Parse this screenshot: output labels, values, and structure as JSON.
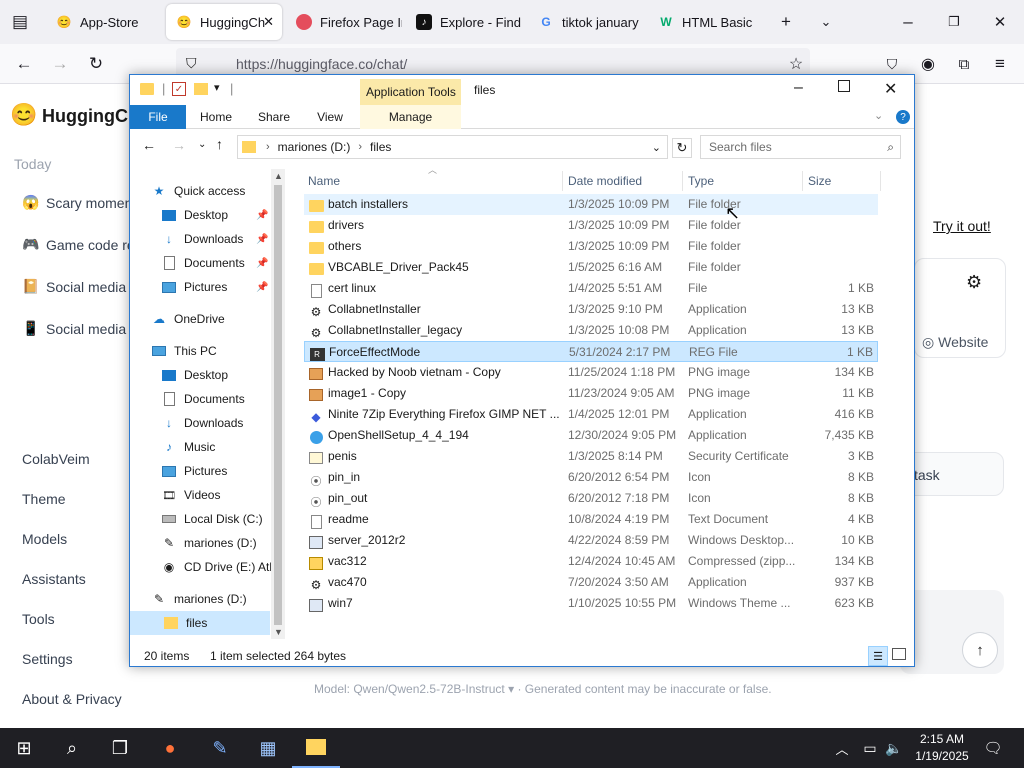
{
  "browser": {
    "tabs": [
      {
        "label": "App-Store",
        "icon": "hugging-face-icon"
      },
      {
        "label": "HuggingCh",
        "icon": "hugging-face-icon",
        "active": true
      },
      {
        "label": "Firefox Page In",
        "icon": "firefox-icon"
      },
      {
        "label": "Explore - Find",
        "icon": "tiktok-icon"
      },
      {
        "label": "tiktok january",
        "icon": "google-icon"
      },
      {
        "label": "HTML Basic",
        "icon": "w3schools-icon"
      }
    ],
    "url": "https://huggingface.co/chat/"
  },
  "page": {
    "brand": "HuggingCh",
    "today": "Today",
    "chats": [
      "Scary momen",
      "Game code re",
      "Social media b",
      "Social media ap"
    ],
    "menu": [
      "ColabVeim",
      "Theme",
      "Models",
      "Assistants",
      "Tools",
      "Settings",
      "About & Privacy"
    ],
    "try_it": "Try it out!",
    "website": "Website",
    "task": "task",
    "footer": "Model: Qwen/Qwen2.5-72B-Instruct ▾ · Generated content may be inaccurate or false."
  },
  "explorer": {
    "title": "files",
    "app_tools": "Application Tools",
    "ribbon": {
      "file": "File",
      "home": "Home",
      "share": "Share",
      "view": "View",
      "manage": "Manage"
    },
    "address": {
      "drive": "mariones (D:)",
      "folder": "files"
    },
    "search_placeholder": "Search files",
    "nav": {
      "quick_access": "Quick access",
      "qa_items": [
        "Desktop",
        "Downloads",
        "Documents",
        "Pictures"
      ],
      "onedrive": "OneDrive",
      "this_pc": "This PC",
      "pc_items": [
        "Desktop",
        "Documents",
        "Downloads",
        "Music",
        "Pictures",
        "Videos",
        "Local Disk (C:)",
        "mariones (D:)",
        "CD Drive (E:) Atla"
      ],
      "drive": "mariones (D:)",
      "files": "files"
    },
    "columns": {
      "name": "Name",
      "date": "Date modified",
      "type": "Type",
      "size": "Size"
    },
    "files": [
      {
        "name": "batch installers",
        "date": "1/3/2025 10:09 PM",
        "type": "File folder",
        "size": "",
        "icon": "folder-icon"
      },
      {
        "name": "drivers",
        "date": "1/3/2025 10:09 PM",
        "type": "File folder",
        "size": "",
        "icon": "folder-icon"
      },
      {
        "name": "others",
        "date": "1/3/2025 10:09 PM",
        "type": "File folder",
        "size": "",
        "icon": "folder-icon"
      },
      {
        "name": "VBCABLE_Driver_Pack45",
        "date": "1/5/2025 6:16 AM",
        "type": "File folder",
        "size": "",
        "icon": "folder-icon"
      },
      {
        "name": "cert linux",
        "date": "1/4/2025 5:51 AM",
        "type": "File",
        "size": "1 KB",
        "icon": "file-icon"
      },
      {
        "name": "CollabnetInstaller",
        "date": "1/3/2025 9:10 PM",
        "type": "Application",
        "size": "13 KB",
        "icon": "app-icon"
      },
      {
        "name": "CollabnetInstaller_legacy",
        "date": "1/3/2025 10:08 PM",
        "type": "Application",
        "size": "13 KB",
        "icon": "app-icon"
      },
      {
        "name": "ForceEffectMode",
        "date": "5/31/2024 2:17 PM",
        "type": "REG File",
        "size": "1 KB",
        "icon": "reg-icon"
      },
      {
        "name": "Hacked by Noob vietnam - Copy",
        "date": "11/25/2024 1:18 PM",
        "type": "PNG image",
        "size": "134 KB",
        "icon": "image-icon"
      },
      {
        "name": "image1 - Copy",
        "date": "11/23/2024 9:05 AM",
        "type": "PNG image",
        "size": "11 KB",
        "icon": "image-icon"
      },
      {
        "name": "Ninite 7Zip Everything Firefox GIMP NET ...",
        "date": "1/4/2025 12:01 PM",
        "type": "Application",
        "size": "416 KB",
        "icon": "ninite-icon"
      },
      {
        "name": "OpenShellSetup_4_4_194",
        "date": "12/30/2024 9:05 PM",
        "type": "Application",
        "size": "7,435 KB",
        "icon": "shell-icon"
      },
      {
        "name": "penis",
        "date": "1/3/2025 8:14 PM",
        "type": "Security Certificate",
        "size": "3 KB",
        "icon": "certificate-icon"
      },
      {
        "name": "pin_in",
        "date": "6/20/2012 6:54 PM",
        "type": "Icon",
        "size": "8 KB",
        "icon": "pin-icon"
      },
      {
        "name": "pin_out",
        "date": "6/20/2012 7:18 PM",
        "type": "Icon",
        "size": "8 KB",
        "icon": "pin-icon"
      },
      {
        "name": "readme",
        "date": "10/8/2024 4:19 PM",
        "type": "Text Document",
        "size": "4 KB",
        "icon": "text-file-icon"
      },
      {
        "name": "server_2012r2",
        "date": "4/22/2024 8:59 PM",
        "type": "Windows Desktop...",
        "size": "10 KB",
        "icon": "theme-file-icon"
      },
      {
        "name": "vac312",
        "date": "12/4/2024 10:45 AM",
        "type": "Compressed (zipp...",
        "size": "134 KB",
        "icon": "zip-icon"
      },
      {
        "name": "vac470",
        "date": "7/20/2024 3:50 AM",
        "type": "Application",
        "size": "937 KB",
        "icon": "app-icon"
      },
      {
        "name": "win7",
        "date": "1/10/2025 10:55 PM",
        "type": "Windows Theme ...",
        "size": "623 KB",
        "icon": "theme-file-icon"
      }
    ],
    "status": {
      "count": "20 items",
      "selected": "1 item selected",
      "size": "264 bytes"
    }
  },
  "taskbar": {
    "time": "2:15 AM",
    "date": "1/19/2025"
  },
  "colors": {
    "accent": "#0078d4",
    "selection": "#cce8ff",
    "folder": "#ffd45f",
    "taskbar": "#1f1f24"
  }
}
